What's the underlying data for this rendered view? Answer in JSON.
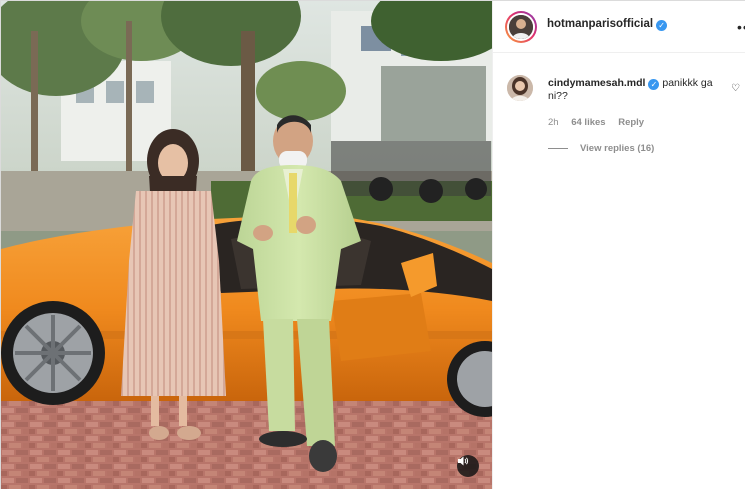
{
  "post": {
    "author": "hotmanparisofficial",
    "author_verified": true,
    "more_icon": "more-horizontal-icon"
  },
  "media": {
    "type": "video",
    "mute_icon": "speaker-icon"
  },
  "comments": [
    {
      "user": "cindymamesah.mdl",
      "verified": true,
      "text": "panikkk ga ni??",
      "time": "2h",
      "likes": "64 likes",
      "reply_label": "Reply",
      "view_replies": "View replies (16)",
      "heart_icon": "heart-outline-icon"
    }
  ],
  "colors": {
    "verified_blue": "#3897f0",
    "car_orange": "#f08a1e",
    "suit_green": "#cfe3a8",
    "secondary_text": "#8e8e8e"
  }
}
